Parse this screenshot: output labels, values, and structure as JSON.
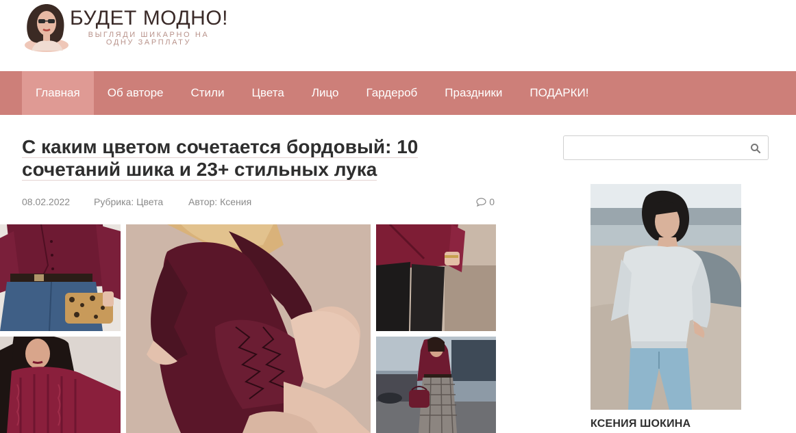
{
  "site": {
    "title": "БУДЕТ МОДНО!",
    "tagline_line1": "ВЫГЛЯДИ ШИКАРНО НА",
    "tagline_line2": "ОДНУ ЗАРПЛАТУ"
  },
  "nav": {
    "items": [
      {
        "label": "Главная",
        "active": true
      },
      {
        "label": "Об авторе"
      },
      {
        "label": "Стили"
      },
      {
        "label": "Цвета"
      },
      {
        "label": "Лицо"
      },
      {
        "label": "Гардероб"
      },
      {
        "label": "Праздники"
      },
      {
        "label": "ПОДАРКИ!"
      }
    ]
  },
  "article": {
    "title_line1": "С каким цветом сочетается бордовый: 10",
    "title_line2": "сочетаний шика и 23+ стильных лука",
    "date": "08.02.2022",
    "rubric": "Рубрика: Цвета",
    "author": "Автор: Ксения",
    "comments_count": "0"
  },
  "sidebar": {
    "search_value": "",
    "author_name": "КСЕНИЯ ШОКИНА"
  },
  "colors": {
    "nav_bg": "#cd7f79",
    "nav_active": "#df9a94",
    "burgundy": "#6b1a2e"
  },
  "icons": [
    "search-icon",
    "comment-icon"
  ]
}
